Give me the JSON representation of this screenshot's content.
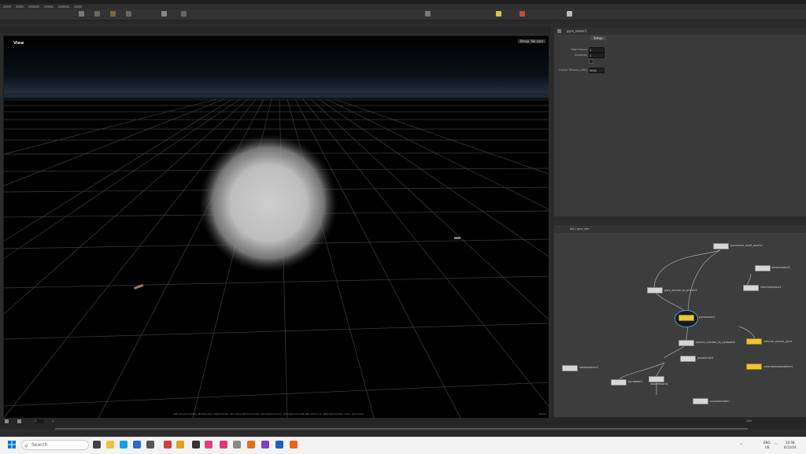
{
  "viewport": {
    "label": "View",
    "camera_button": "Persp",
    "display_button": "No cam",
    "status_text": "Left mouse tumbles. Middle pans. Right dollies. Ctrl+Alt+Left box-zooms. Ctrl+Right zooms. Spacebar-Ctrl-Left tilts. Hold L for alternate tumble, dolly, and zoom.",
    "persp_label": "Persp"
  },
  "param_pane": {
    "node_name": "pyro_solver1",
    "tab": "Setup",
    "rows": [
      {
        "label": "Start Frame",
        "value": "1"
      },
      {
        "label": "Substeps",
        "value": "1"
      },
      {
        "label": "Cache Simulation",
        "value": ""
      },
      {
        "label": "Cache Memory (MB)",
        "value": "5000"
      }
    ]
  },
  "network_pane": {
    "path_label": "obj / pyro_sim",
    "nodes": [
      {
        "name": "pyrosolve_shelf_source"
      },
      {
        "name": "pyro_source_to_physic2"
      },
      {
        "name": "smokeobject1"
      },
      {
        "name": "volumeoutput1"
      },
      {
        "name": "pyrosolver1"
      },
      {
        "name": "source_volume_to_pyrosolve"
      },
      {
        "name": "volume_source_pyro"
      },
      {
        "name": "gasdisturb1"
      },
      {
        "name": "volumevisualization1"
      },
      {
        "name": "smokesolver1"
      },
      {
        "name": "pyrobake1"
      },
      {
        "name": "dopnetwork1"
      },
      {
        "name": "outputsmoke1"
      }
    ]
  },
  "timeline": {
    "start_frame": "1",
    "end_frame": "240",
    "current_frame": "1"
  },
  "taskbar": {
    "search_placeholder": "Search",
    "language": "ENG",
    "region": "US",
    "time": "10:58",
    "date": "6/12/24"
  },
  "colors": {
    "node_selected": "#e8c53a",
    "viewport_bg": "#000000",
    "panel_bg": "#3a3a3a"
  }
}
